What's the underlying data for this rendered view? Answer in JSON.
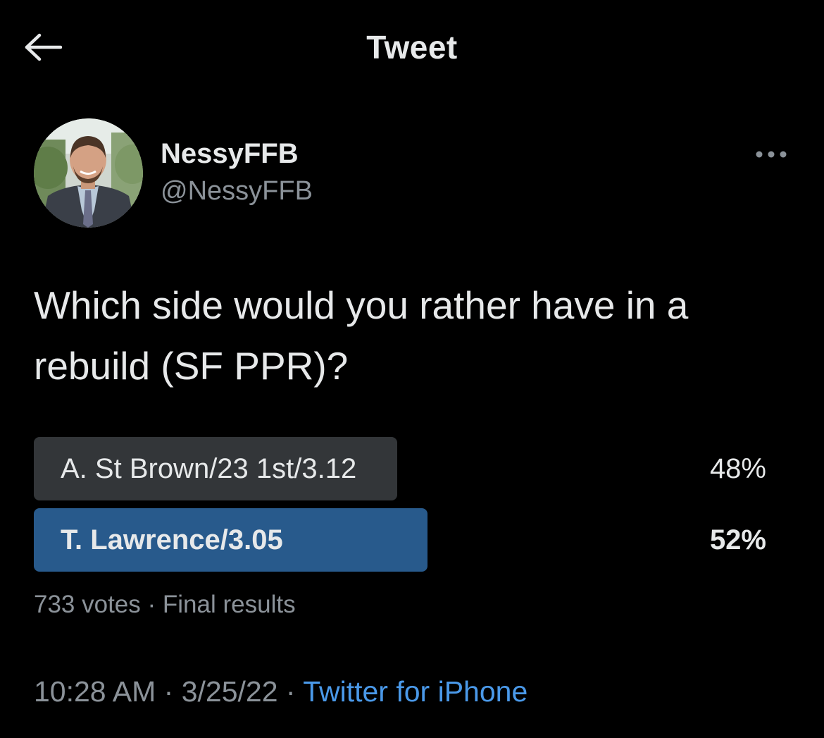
{
  "header": {
    "title": "Tweet"
  },
  "author": {
    "name": "NessyFFB",
    "handle": "@NessyFFB"
  },
  "tweet": {
    "text_line1": "Which side would you rather have in a",
    "text_line2": "rebuild (SF PPR)?"
  },
  "poll": {
    "options": [
      {
        "label": "A. St Brown/23 1st/3.12",
        "percent_label": "48%",
        "percent": 48,
        "winner": false
      },
      {
        "label": "T. Lawrence/3.05",
        "percent_label": "52%",
        "percent": 52,
        "winner": true
      }
    ],
    "votes": "733 votes",
    "separator": "·",
    "status": "Final results"
  },
  "meta": {
    "time": "10:28 AM",
    "date": "3/25/22",
    "separator": "·",
    "source": "Twitter for iPhone"
  },
  "colors": {
    "background": "#000000",
    "text_primary": "#e7e9ea",
    "text_secondary": "#8b9299",
    "link": "#4a99e9",
    "poll_winner": "#285a8c",
    "poll_loser": "#333639"
  },
  "icons": {
    "back": "arrow-left-icon",
    "more": "more-horizontal-icon"
  }
}
